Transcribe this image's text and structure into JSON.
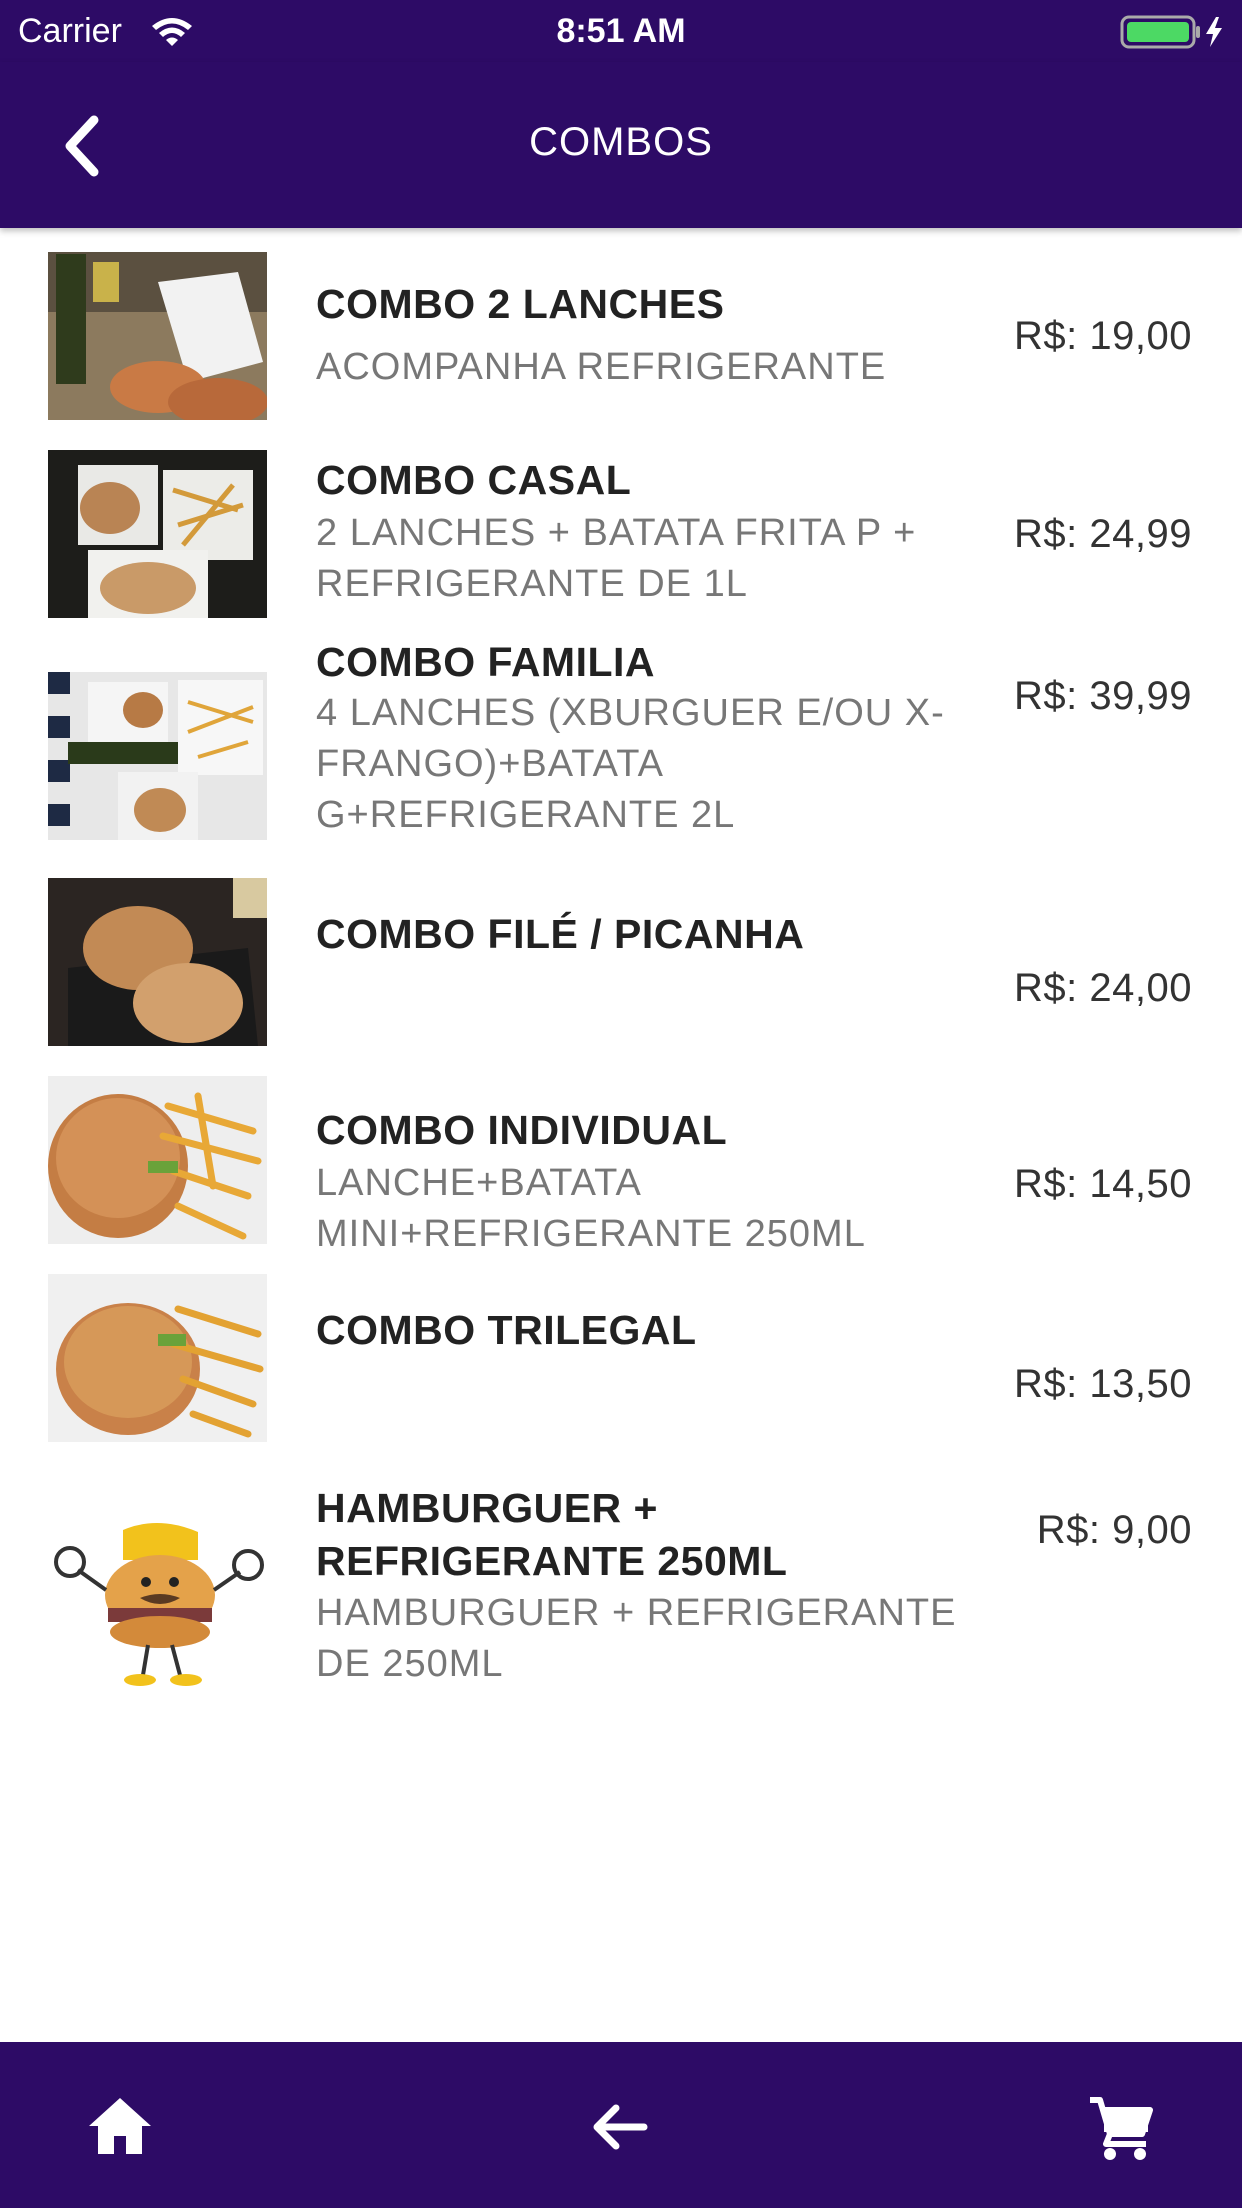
{
  "status": {
    "carrier": "Carrier",
    "time": "8:51 AM"
  },
  "header": {
    "title": "COMBOS",
    "back_icon": "chevron-left-icon"
  },
  "colors": {
    "primary": "#2d0b66",
    "name_text": "#222222",
    "desc_text": "#777777",
    "battery": "#4cd964"
  },
  "combos": [
    {
      "name": "COMBO 2 LANCHES",
      "desc": "ACOMPANHA REFRIGERANTE",
      "price": "R$: 19,00"
    },
    {
      "name": "COMBO CASAL",
      "desc": "2 LANCHES + BATATA FRITA P + REFRIGERANTE DE 1L",
      "price": "R$: 24,99"
    },
    {
      "name": "COMBO FAMILIA",
      "desc": "4 LANCHES (XBURGUER E/OU X-FRANGO)+BATATA G+REFRIGERANTE 2L",
      "price": "R$: 39,99"
    },
    {
      "name": "COMBO FILÉ / PICANHA",
      "desc": "",
      "price": "R$: 24,00"
    },
    {
      "name": "COMBO INDIVIDUAL",
      "desc": "LANCHE+BATATA MINI+REFRIGERANTE 250ML",
      "price": "R$: 14,50"
    },
    {
      "name": "COMBO TRILEGAL",
      "desc": "",
      "price": "R$: 13,50"
    },
    {
      "name": "HAMBURGUER + REFRIGERANTE 250ML",
      "desc": "HAMBURGUER + REFRIGERANTE DE 250ML",
      "price": "R$: 9,00"
    }
  ],
  "bottom_nav": {
    "home_icon": "home-icon",
    "back_icon": "arrow-left-icon",
    "cart_icon": "cart-icon"
  }
}
